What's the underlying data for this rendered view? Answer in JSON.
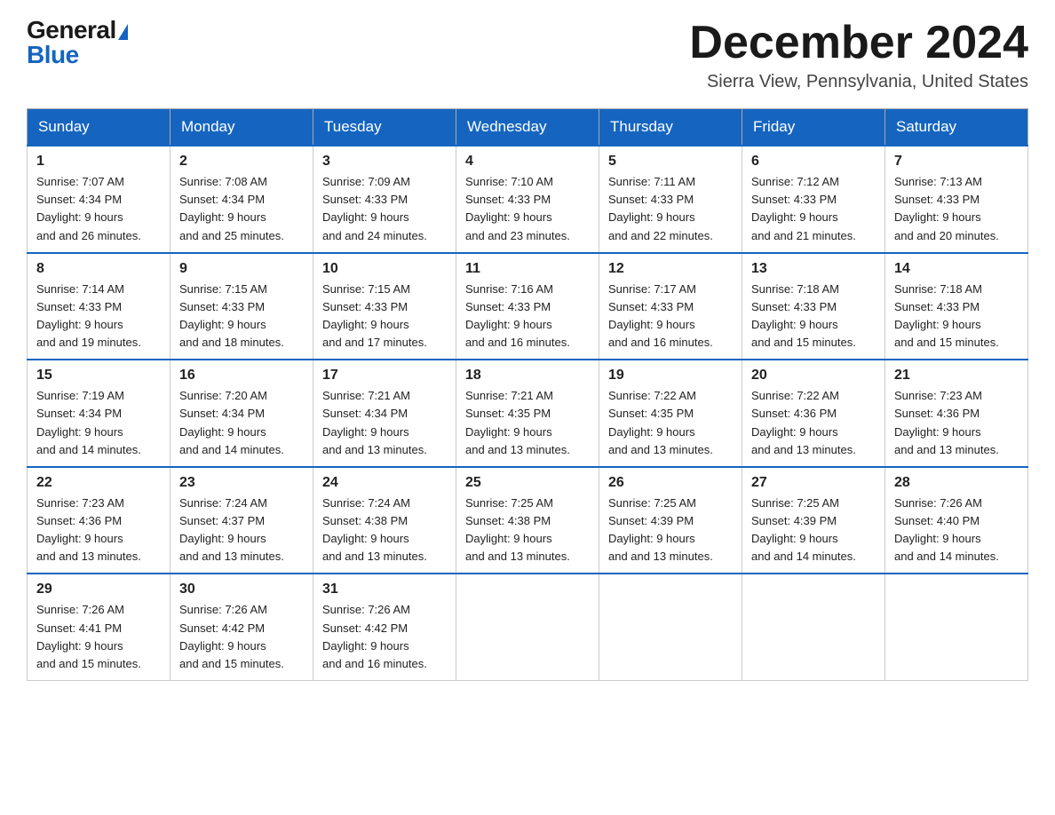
{
  "logo": {
    "general": "General",
    "blue": "Blue"
  },
  "header": {
    "month_title": "December 2024",
    "location": "Sierra View, Pennsylvania, United States"
  },
  "days_of_week": [
    "Sunday",
    "Monday",
    "Tuesday",
    "Wednesday",
    "Thursday",
    "Friday",
    "Saturday"
  ],
  "weeks": [
    [
      {
        "day": "1",
        "sunrise": "7:07 AM",
        "sunset": "4:34 PM",
        "daylight": "9 hours and 26 minutes."
      },
      {
        "day": "2",
        "sunrise": "7:08 AM",
        "sunset": "4:34 PM",
        "daylight": "9 hours and 25 minutes."
      },
      {
        "day": "3",
        "sunrise": "7:09 AM",
        "sunset": "4:33 PM",
        "daylight": "9 hours and 24 minutes."
      },
      {
        "day": "4",
        "sunrise": "7:10 AM",
        "sunset": "4:33 PM",
        "daylight": "9 hours and 23 minutes."
      },
      {
        "day": "5",
        "sunrise": "7:11 AM",
        "sunset": "4:33 PM",
        "daylight": "9 hours and 22 minutes."
      },
      {
        "day": "6",
        "sunrise": "7:12 AM",
        "sunset": "4:33 PM",
        "daylight": "9 hours and 21 minutes."
      },
      {
        "day": "7",
        "sunrise": "7:13 AM",
        "sunset": "4:33 PM",
        "daylight": "9 hours and 20 minutes."
      }
    ],
    [
      {
        "day": "8",
        "sunrise": "7:14 AM",
        "sunset": "4:33 PM",
        "daylight": "9 hours and 19 minutes."
      },
      {
        "day": "9",
        "sunrise": "7:15 AM",
        "sunset": "4:33 PM",
        "daylight": "9 hours and 18 minutes."
      },
      {
        "day": "10",
        "sunrise": "7:15 AM",
        "sunset": "4:33 PM",
        "daylight": "9 hours and 17 minutes."
      },
      {
        "day": "11",
        "sunrise": "7:16 AM",
        "sunset": "4:33 PM",
        "daylight": "9 hours and 16 minutes."
      },
      {
        "day": "12",
        "sunrise": "7:17 AM",
        "sunset": "4:33 PM",
        "daylight": "9 hours and 16 minutes."
      },
      {
        "day": "13",
        "sunrise": "7:18 AM",
        "sunset": "4:33 PM",
        "daylight": "9 hours and 15 minutes."
      },
      {
        "day": "14",
        "sunrise": "7:18 AM",
        "sunset": "4:33 PM",
        "daylight": "9 hours and 15 minutes."
      }
    ],
    [
      {
        "day": "15",
        "sunrise": "7:19 AM",
        "sunset": "4:34 PM",
        "daylight": "9 hours and 14 minutes."
      },
      {
        "day": "16",
        "sunrise": "7:20 AM",
        "sunset": "4:34 PM",
        "daylight": "9 hours and 14 minutes."
      },
      {
        "day": "17",
        "sunrise": "7:21 AM",
        "sunset": "4:34 PM",
        "daylight": "9 hours and 13 minutes."
      },
      {
        "day": "18",
        "sunrise": "7:21 AM",
        "sunset": "4:35 PM",
        "daylight": "9 hours and 13 minutes."
      },
      {
        "day": "19",
        "sunrise": "7:22 AM",
        "sunset": "4:35 PM",
        "daylight": "9 hours and 13 minutes."
      },
      {
        "day": "20",
        "sunrise": "7:22 AM",
        "sunset": "4:36 PM",
        "daylight": "9 hours and 13 minutes."
      },
      {
        "day": "21",
        "sunrise": "7:23 AM",
        "sunset": "4:36 PM",
        "daylight": "9 hours and 13 minutes."
      }
    ],
    [
      {
        "day": "22",
        "sunrise": "7:23 AM",
        "sunset": "4:36 PM",
        "daylight": "9 hours and 13 minutes."
      },
      {
        "day": "23",
        "sunrise": "7:24 AM",
        "sunset": "4:37 PM",
        "daylight": "9 hours and 13 minutes."
      },
      {
        "day": "24",
        "sunrise": "7:24 AM",
        "sunset": "4:38 PM",
        "daylight": "9 hours and 13 minutes."
      },
      {
        "day": "25",
        "sunrise": "7:25 AM",
        "sunset": "4:38 PM",
        "daylight": "9 hours and 13 minutes."
      },
      {
        "day": "26",
        "sunrise": "7:25 AM",
        "sunset": "4:39 PM",
        "daylight": "9 hours and 13 minutes."
      },
      {
        "day": "27",
        "sunrise": "7:25 AM",
        "sunset": "4:39 PM",
        "daylight": "9 hours and 14 minutes."
      },
      {
        "day": "28",
        "sunrise": "7:26 AM",
        "sunset": "4:40 PM",
        "daylight": "9 hours and 14 minutes."
      }
    ],
    [
      {
        "day": "29",
        "sunrise": "7:26 AM",
        "sunset": "4:41 PM",
        "daylight": "9 hours and 15 minutes."
      },
      {
        "day": "30",
        "sunrise": "7:26 AM",
        "sunset": "4:42 PM",
        "daylight": "9 hours and 15 minutes."
      },
      {
        "day": "31",
        "sunrise": "7:26 AM",
        "sunset": "4:42 PM",
        "daylight": "9 hours and 16 minutes."
      },
      null,
      null,
      null,
      null
    ]
  ],
  "labels": {
    "sunrise": "Sunrise:",
    "sunset": "Sunset:",
    "daylight": "Daylight:"
  }
}
